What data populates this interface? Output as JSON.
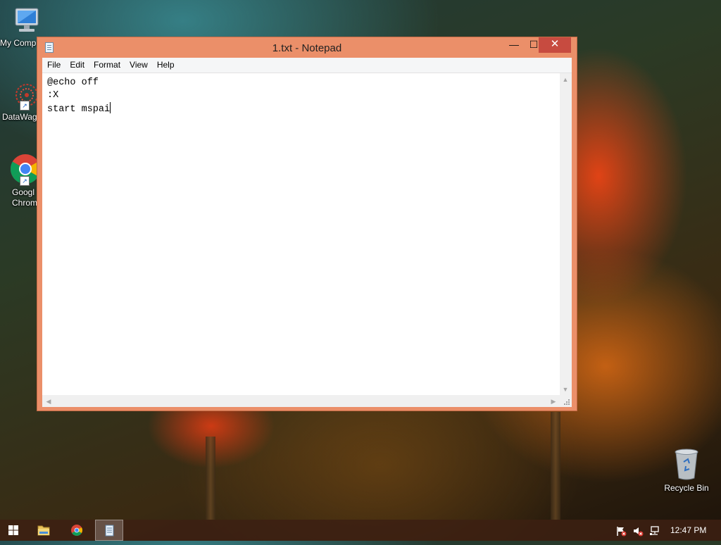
{
  "desktop": {
    "icons": [
      {
        "label": "My Comp",
        "icon": "computer-icon"
      },
      {
        "label": "DataWag",
        "icon": "datawag-icon"
      },
      {
        "label": "Googl\nChrom",
        "icon": "chrome-icon"
      },
      {
        "label": "Recycle Bin",
        "icon": "recycle-bin-icon"
      }
    ]
  },
  "window": {
    "title": "1.txt - Notepad",
    "controls": {
      "minimize": "—",
      "maximize": "☐",
      "close": "✕"
    },
    "menu": [
      "File",
      "Edit",
      "Format",
      "View",
      "Help"
    ],
    "content_lines": [
      "@echo off",
      ":X",
      "start mspai"
    ]
  },
  "taskbar": {
    "items": [
      "windows-start-icon",
      "file-explorer-icon",
      "chrome-icon",
      "notepad-icon"
    ],
    "active_item": "notepad-icon",
    "tray_icons": [
      "action-center-flag-icon",
      "volume-muted-icon",
      "network-icon"
    ],
    "clock": "12:47 PM"
  },
  "colors": {
    "window_frame": "#eb8f69",
    "close_button": "#c74b40",
    "taskbar": "#3c2012"
  }
}
